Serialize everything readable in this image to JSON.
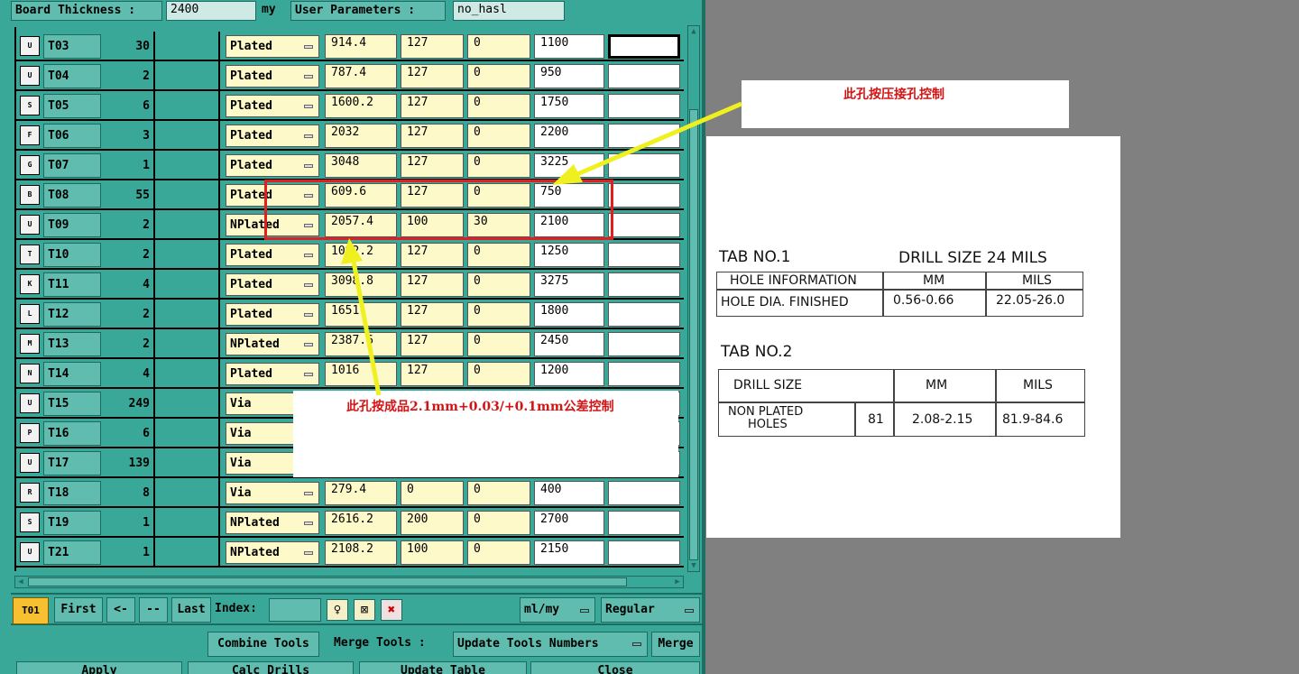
{
  "topbar": {
    "board_thickness_label": "Board Thickness :",
    "board_thickness_value": "2400",
    "board_thickness_unit": "my",
    "user_params_label": "User Parameters :",
    "user_params_value": "no_hasl"
  },
  "rows": [
    {
      "tool": "T03",
      "qty": "30",
      "type": "Plated",
      "finish": "914.4",
      "tol_plus": "127",
      "tol_minus": "0",
      "drill": "1100",
      "last": "",
      "icon": "U"
    },
    {
      "tool": "T04",
      "qty": "2",
      "type": "Plated",
      "finish": "787.4",
      "tol_plus": "127",
      "tol_minus": "0",
      "drill": "950",
      "last": "",
      "icon": "U"
    },
    {
      "tool": "T05",
      "qty": "6",
      "type": "Plated",
      "finish": "1600.2",
      "tol_plus": "127",
      "tol_minus": "0",
      "drill": "1750",
      "last": "",
      "icon": "S"
    },
    {
      "tool": "T06",
      "qty": "3",
      "type": "Plated",
      "finish": "2032",
      "tol_plus": "127",
      "tol_minus": "0",
      "drill": "2200",
      "last": "",
      "icon": "F"
    },
    {
      "tool": "T07",
      "qty": "1",
      "type": "Plated",
      "finish": "3048",
      "tol_plus": "127",
      "tol_minus": "0",
      "drill": "3225",
      "last": "",
      "icon": "G"
    },
    {
      "tool": "T08",
      "qty": "55",
      "type": "Plated",
      "finish": "609.6",
      "tol_plus": "127",
      "tol_minus": "0",
      "drill": "750",
      "last": "",
      "icon": "B"
    },
    {
      "tool": "T09",
      "qty": "2",
      "type": "NPlated",
      "finish": "2057.4",
      "tol_plus": "100",
      "tol_minus": "30",
      "drill": "2100",
      "last": "",
      "icon": "U"
    },
    {
      "tool": "T10",
      "qty": "2",
      "type": "Plated",
      "finish": "1092.2",
      "tol_plus": "127",
      "tol_minus": "0",
      "drill": "1250",
      "last": "",
      "icon": "T"
    },
    {
      "tool": "T11",
      "qty": "4",
      "type": "Plated",
      "finish": "3098.8",
      "tol_plus": "127",
      "tol_minus": "0",
      "drill": "3275",
      "last": "",
      "icon": "K"
    },
    {
      "tool": "T12",
      "qty": "2",
      "type": "Plated",
      "finish": "1651",
      "tol_plus": "127",
      "tol_minus": "0",
      "drill": "1800",
      "last": "",
      "icon": "L"
    },
    {
      "tool": "T13",
      "qty": "2",
      "type": "NPlated",
      "finish": "2387.6",
      "tol_plus": "127",
      "tol_minus": "0",
      "drill": "2450",
      "last": "",
      "icon": "M"
    },
    {
      "tool": "T14",
      "qty": "4",
      "type": "Plated",
      "finish": "1016",
      "tol_plus": "127",
      "tol_minus": "0",
      "drill": "1200",
      "last": "",
      "icon": "N"
    },
    {
      "tool": "T15",
      "qty": "249",
      "type": "Via",
      "finish": "",
      "tol_plus": "",
      "tol_minus": "",
      "drill": "",
      "last": "",
      "icon": "U"
    },
    {
      "tool": "T16",
      "qty": "6",
      "type": "Via",
      "finish": "",
      "tol_plus": "",
      "tol_minus": "",
      "drill": "",
      "last": "",
      "icon": "P"
    },
    {
      "tool": "T17",
      "qty": "139",
      "type": "Via",
      "finish": "",
      "tol_plus": "",
      "tol_minus": "",
      "drill": "",
      "last": "",
      "icon": "U"
    },
    {
      "tool": "T18",
      "qty": "8",
      "type": "Via",
      "finish": "279.4",
      "tol_plus": "0",
      "tol_minus": "0",
      "drill": "400",
      "last": "",
      "icon": "R"
    },
    {
      "tool": "T19",
      "qty": "1",
      "type": "NPlated",
      "finish": "2616.2",
      "tol_plus": "200",
      "tol_minus": "0",
      "drill": "2700",
      "last": "",
      "icon": "S"
    },
    {
      "tool": "T21",
      "qty": "1",
      "type": "NPlated",
      "finish": "2108.2",
      "tol_plus": "100",
      "tol_minus": "0",
      "drill": "2150",
      "last": "",
      "icon": "U"
    }
  ],
  "nav": {
    "current_tool": "T01",
    "first": "First",
    "prev": "<--",
    "next": "-->",
    "last": "Last",
    "index_label": "Index:",
    "units_select": "ml/my",
    "mode_select": "Regular"
  },
  "merge": {
    "combine": "Combine Tools",
    "merge_label": "Merge Tools :",
    "update_numbers": "Update Tools Numbers",
    "merge": "Merge"
  },
  "bottom": {
    "apply": "Apply",
    "calc": "Calc Drills",
    "update_table": "Update Table",
    "close": "Close"
  },
  "annotations": {
    "top_note": "此孔按压接孔控制",
    "mid_note": "此孔按成品2.1mm+0.03/+0.1mm公差控制",
    "highlight_color": "#e02020",
    "arrow_color": "#f0f020"
  },
  "reference": {
    "tab1_title": "TAB NO.1",
    "tab1_subtitle": "DRILL SIZE 24 MILS",
    "tab1_head": [
      "HOLE INFORMATION",
      "MM",
      "MILS"
    ],
    "tab1_row": [
      "HOLE DIA. FINISHED",
      "0.56-0.66",
      "22.05-26.0"
    ],
    "tab2_title": "TAB NO.2",
    "tab2_head": [
      "DRILL SIZE",
      "MM",
      "MILS"
    ],
    "tab2_row_label_1": "NON PLATED",
    "tab2_row_label_2": "HOLES",
    "tab2_row": [
      "81",
      "2.08-2.15",
      "81.9-84.6"
    ]
  }
}
